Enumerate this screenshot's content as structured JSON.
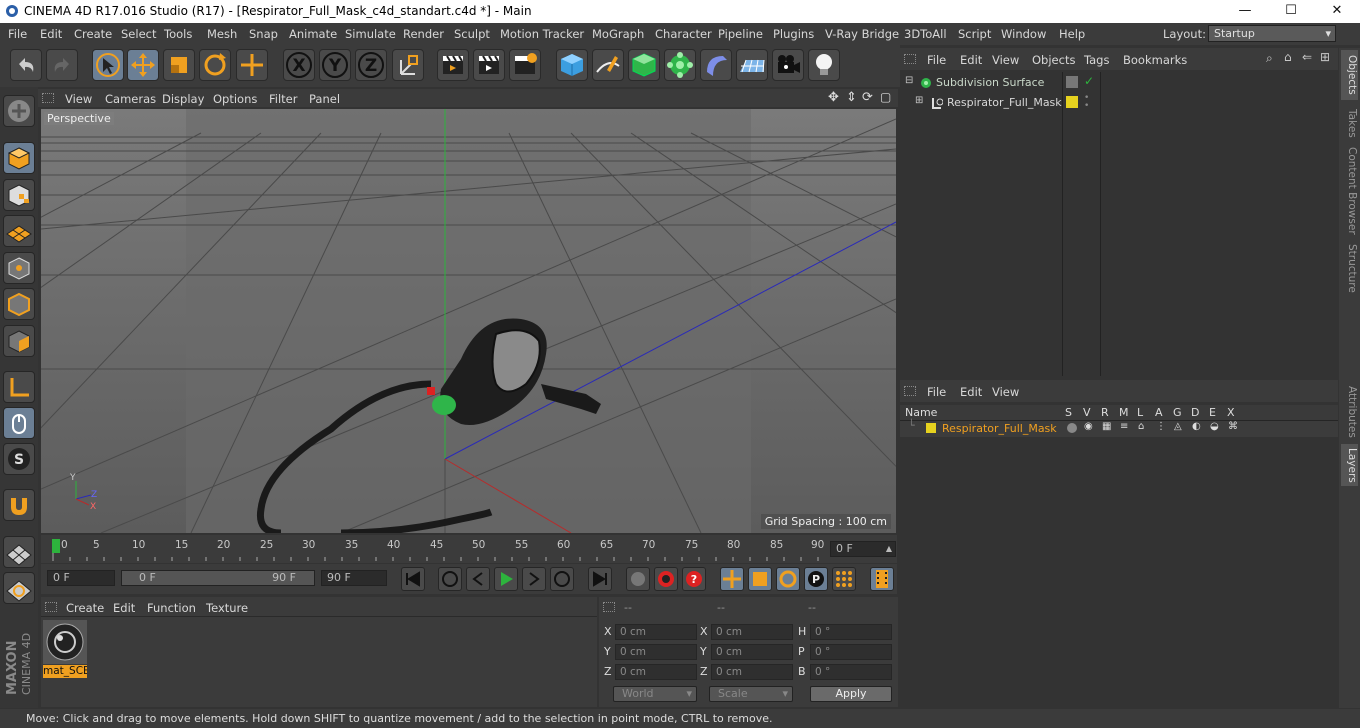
{
  "window": {
    "title": "CINEMA 4D R17.016 Studio (R17) - [Respirator_Full_Mask_c4d_standart.c4d *] - Main",
    "minimize": "—",
    "maximize": "☐",
    "close": "✕"
  },
  "menubar": {
    "items": [
      "File",
      "Edit",
      "Create",
      "Select",
      "Tools",
      "Mesh",
      "Snap",
      "Animate",
      "Simulate",
      "Render",
      "Sculpt",
      "Motion Tracker",
      "MoGraph",
      "Character",
      "Pipeline",
      "Plugins",
      "V-Ray Bridge",
      "3DToAll",
      "Script",
      "Window",
      "Help"
    ],
    "layout_label": "Layout:",
    "layout_value": "Startup"
  },
  "toolbar": {
    "axis_x": "X",
    "axis_y": "Y",
    "axis_z": "Z"
  },
  "viewport": {
    "menu": [
      "View",
      "Cameras",
      "Display",
      "Options",
      "Filter",
      "Panel"
    ],
    "label": "Perspective",
    "grid_spacing": "Grid Spacing : 100 cm",
    "axis_y": "Y",
    "axis_z": "Z",
    "axis_x": "X"
  },
  "timeline": {
    "ticks": [
      "0",
      "5",
      "10",
      "15",
      "20",
      "25",
      "30",
      "35",
      "40",
      "45",
      "50",
      "55",
      "60",
      "65",
      "70",
      "75",
      "80",
      "85",
      "90"
    ],
    "current_frame": "0 F"
  },
  "transport": {
    "start": "0 F",
    "range_start": "0 F",
    "range_end": "90 F",
    "end": "90 F"
  },
  "material_panel": {
    "menu": [
      "Create",
      "Edit",
      "Function",
      "Texture"
    ],
    "material_name": "mat_SCE"
  },
  "coord_panel": {
    "headers": [
      "--",
      "--",
      "--"
    ],
    "rows": [
      {
        "l1": "X",
        "v1": "0 cm",
        "l2": "X",
        "v2": "0 cm",
        "l3": "H",
        "v3": "0 °"
      },
      {
        "l1": "Y",
        "v1": "0 cm",
        "l2": "Y",
        "v2": "0 cm",
        "l3": "P",
        "v3": "0 °"
      },
      {
        "l1": "Z",
        "v1": "0 cm",
        "l2": "Z",
        "v2": "0 cm",
        "l3": "B",
        "v3": "0 °"
      }
    ],
    "world": "World",
    "scale": "Scale",
    "apply": "Apply"
  },
  "object_manager": {
    "menu": [
      "File",
      "Edit",
      "View",
      "Objects",
      "Tags",
      "Bookmarks"
    ],
    "objects": [
      {
        "name": "Subdivision Surface"
      },
      {
        "name": "Respirator_Full_Mask"
      }
    ]
  },
  "layer_manager": {
    "menu": [
      "File",
      "Edit",
      "View"
    ],
    "columns": [
      "Name",
      "S",
      "V",
      "R",
      "M",
      "L",
      "A",
      "G",
      "D",
      "E",
      "X"
    ],
    "layer_name": "Respirator_Full_Mask"
  },
  "side_tabs": [
    "Objects",
    "Takes",
    "Content Browser",
    "Structure",
    "Attributes",
    "Layers"
  ],
  "statusbar": {
    "text": "Move: Click and drag to move elements. Hold down SHIFT to quantize movement / add to the selection in point mode, CTRL to remove."
  },
  "colors": {
    "accent_orange": "#f0a020",
    "layer_yellow": "#e6d21f",
    "selection_blue": "#6b7f95"
  }
}
